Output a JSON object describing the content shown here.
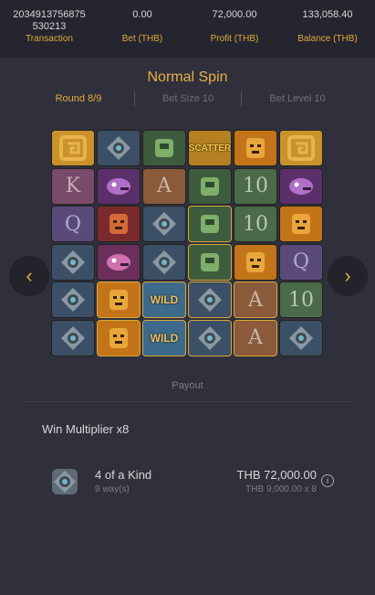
{
  "header": {
    "transaction": {
      "value": "2034913756875\n530213",
      "label": "Transaction"
    },
    "bet": {
      "value": "0.00",
      "label": "Bet (THB)"
    },
    "profit": {
      "value": "72,000.00",
      "label": "Profit (THB)"
    },
    "balance": {
      "value": "133,058.40",
      "label": "Balance (THB)"
    }
  },
  "spin_title": "Normal Spin",
  "round": "Round 8/9",
  "bet_size": "Bet Size 10",
  "bet_level": "Bet Level 10",
  "reels": [
    [
      "totem-frame",
      "shield",
      "glyph",
      "scatter",
      "mask",
      "totem-frame"
    ],
    [
      "K",
      "serpent",
      "A",
      "glyph",
      "10",
      "serpent"
    ],
    [
      "Q",
      "idol",
      "shield",
      "glyph-tall",
      "10",
      "mask"
    ],
    [
      "shield",
      "beast",
      "shield",
      "glyph-tall",
      "mask",
      "Q"
    ],
    [
      "shield",
      "mask-tall",
      "wild",
      "shield-tall",
      "A-tall",
      "10"
    ],
    [
      "shield",
      "mask-tall",
      "wild",
      "shield-tall",
      "A-tall",
      "shield"
    ]
  ],
  "symbol_texts": {
    "scatter": "SCATTER",
    "wild": "WILD"
  },
  "payout_label": "Payout",
  "win_multiplier": "Win Multiplier x8",
  "win": {
    "symbol_icon": "shield-icon",
    "kind": "4 of a Kind",
    "ways": "9 way(s)",
    "amount": "THB 72,000.00",
    "calc": "THB 9,000.00 x 8"
  },
  "nav": {
    "prev_icon": "chevron-left-icon",
    "next_icon": "chevron-right-icon"
  },
  "colors": {
    "accent": "#e0a93a",
    "background": "#30303c",
    "header_bg": "#252530"
  }
}
